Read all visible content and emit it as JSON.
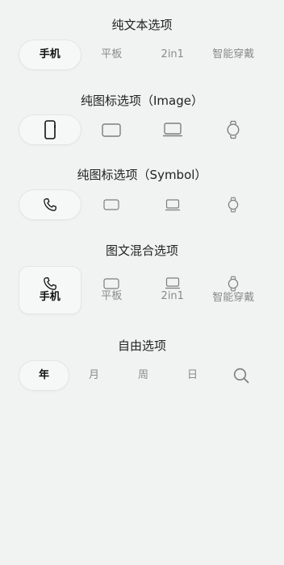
{
  "sections": [
    {
      "title": "纯文本选项",
      "items": [
        "手机",
        "平板",
        "2in1",
        "智能穿戴"
      ],
      "selected_index": 0
    },
    {
      "title": "纯图标选项（Image）",
      "icons": [
        "phone-outline-icon",
        "tablet-icon",
        "laptop-icon",
        "watch-icon"
      ],
      "selected_index": 0
    },
    {
      "title": "纯图标选项（Symbol）",
      "icons": [
        "handset-icon",
        "tablet-icon",
        "laptop-icon",
        "watch-icon"
      ],
      "selected_index": 0
    },
    {
      "title": "图文混合选项",
      "items": [
        "手机",
        "平板",
        "2in1",
        "智能穿戴"
      ],
      "icons": [
        "handset-icon",
        "tablet-icon",
        "laptop-icon",
        "watch-icon"
      ],
      "selected_index": 0
    },
    {
      "title": "自由选项",
      "items": [
        "年",
        "月",
        "周",
        "日"
      ],
      "extra_icon": "search-icon",
      "selected_index": 0
    }
  ],
  "colors": {
    "background": "#f1f3f2",
    "selected_bg": "#f6f7f7",
    "selected_text": "#111111",
    "unselected_text": "#8a8a8a"
  }
}
